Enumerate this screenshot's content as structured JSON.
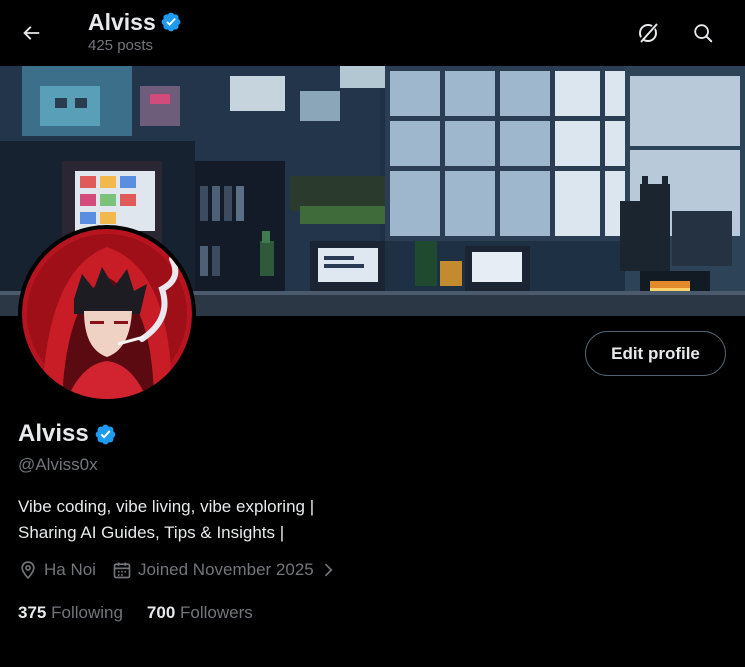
{
  "header": {
    "name": "Alviss",
    "posts_count": "425 posts",
    "icons": [
      "back-arrow-icon",
      "grok-icon",
      "search-icon"
    ]
  },
  "profile": {
    "display_name": "Alviss",
    "handle": "@Alviss0x",
    "verified": true,
    "bio_line1": "Vibe coding, vibe living, vibe exploring |",
    "bio_line2": "Sharing AI Guides, Tips & Insights |",
    "location": "Ha Noi",
    "joined": "Joined November 2025",
    "edit_button": "Edit profile"
  },
  "stats": {
    "following_count": "375",
    "following_label": "Following",
    "followers_count": "700",
    "followers_label": "Followers"
  },
  "colors": {
    "background": "#000000",
    "text_primary": "#e7e9ea",
    "text_secondary": "#71767b",
    "verified_blue": "#1d9bf0",
    "button_border": "#536471"
  }
}
